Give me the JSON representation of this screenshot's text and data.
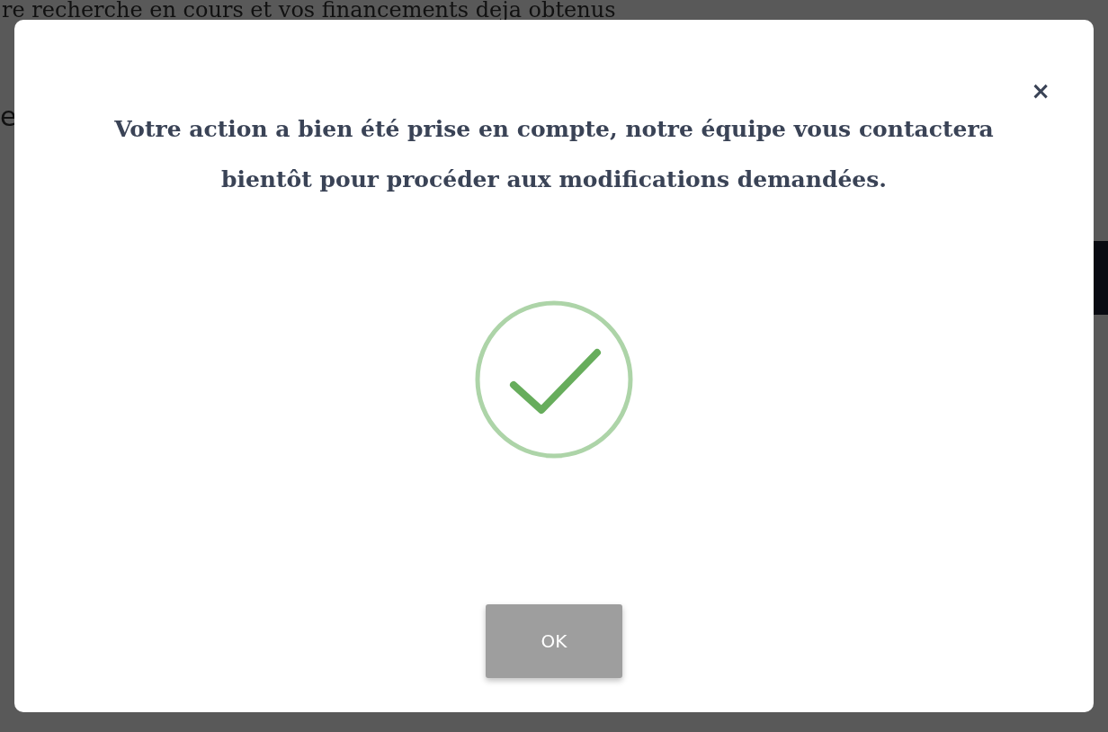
{
  "background_page": {
    "heading": "re recherche en cours et vos financements deja obtenus",
    "left_fragment": "e"
  },
  "dialog": {
    "close": "×",
    "message": "Votre action a bien été prise en compte, notre équipe vous contactera bientôt pour procéder aux modifications demandées.",
    "button": "OK"
  }
}
